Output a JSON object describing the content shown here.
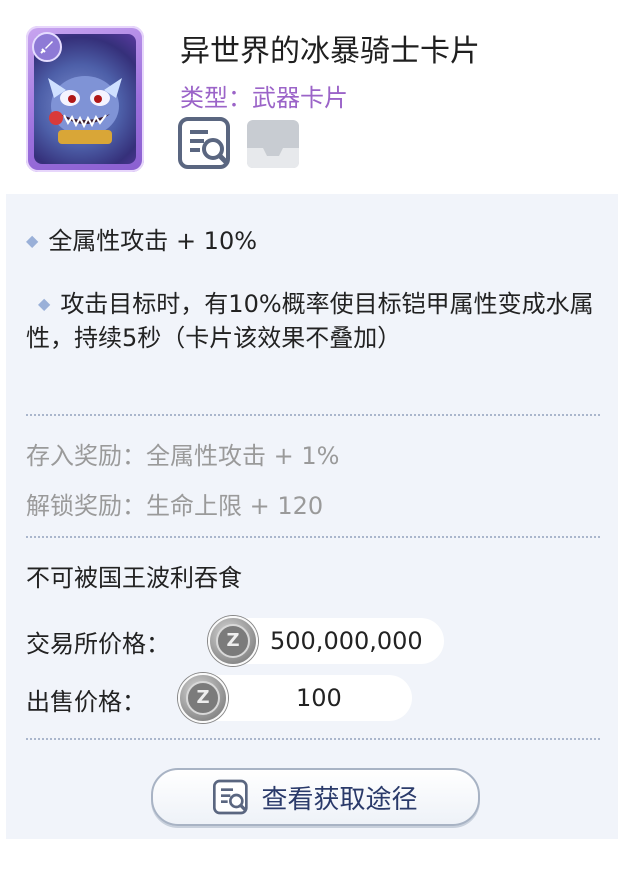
{
  "card": {
    "name": "异世界的冰暴骑士卡片",
    "type_line": "类型：武器卡片",
    "icons": [
      "sword-icon",
      "info-search-icon",
      "tray-icon"
    ]
  },
  "effects": [
    "全属性攻击 + 10%",
    "攻击目标时，有10%概率使目标铠甲属性变成水属性，持续5秒（卡片该效果不叠加）"
  ],
  "rewards": {
    "store": "存入奖励：全属性攻击 + 1%",
    "unlock": "解锁奖励：生命上限 + 120"
  },
  "restriction": "不可被国王波利吞食",
  "prices": {
    "exchange_label": "交易所价格：",
    "exchange_value": "500,000,000",
    "sell_label": "出售价格：",
    "sell_value": "100",
    "coin_icon": "zeny-coin-icon",
    "coin_letter": "Z"
  },
  "action": {
    "label": "查看获取途径"
  },
  "colors": {
    "type_text": "#9b64c8",
    "panel_bg": "#f1f4fa",
    "button_text": "#2a3a6a"
  }
}
